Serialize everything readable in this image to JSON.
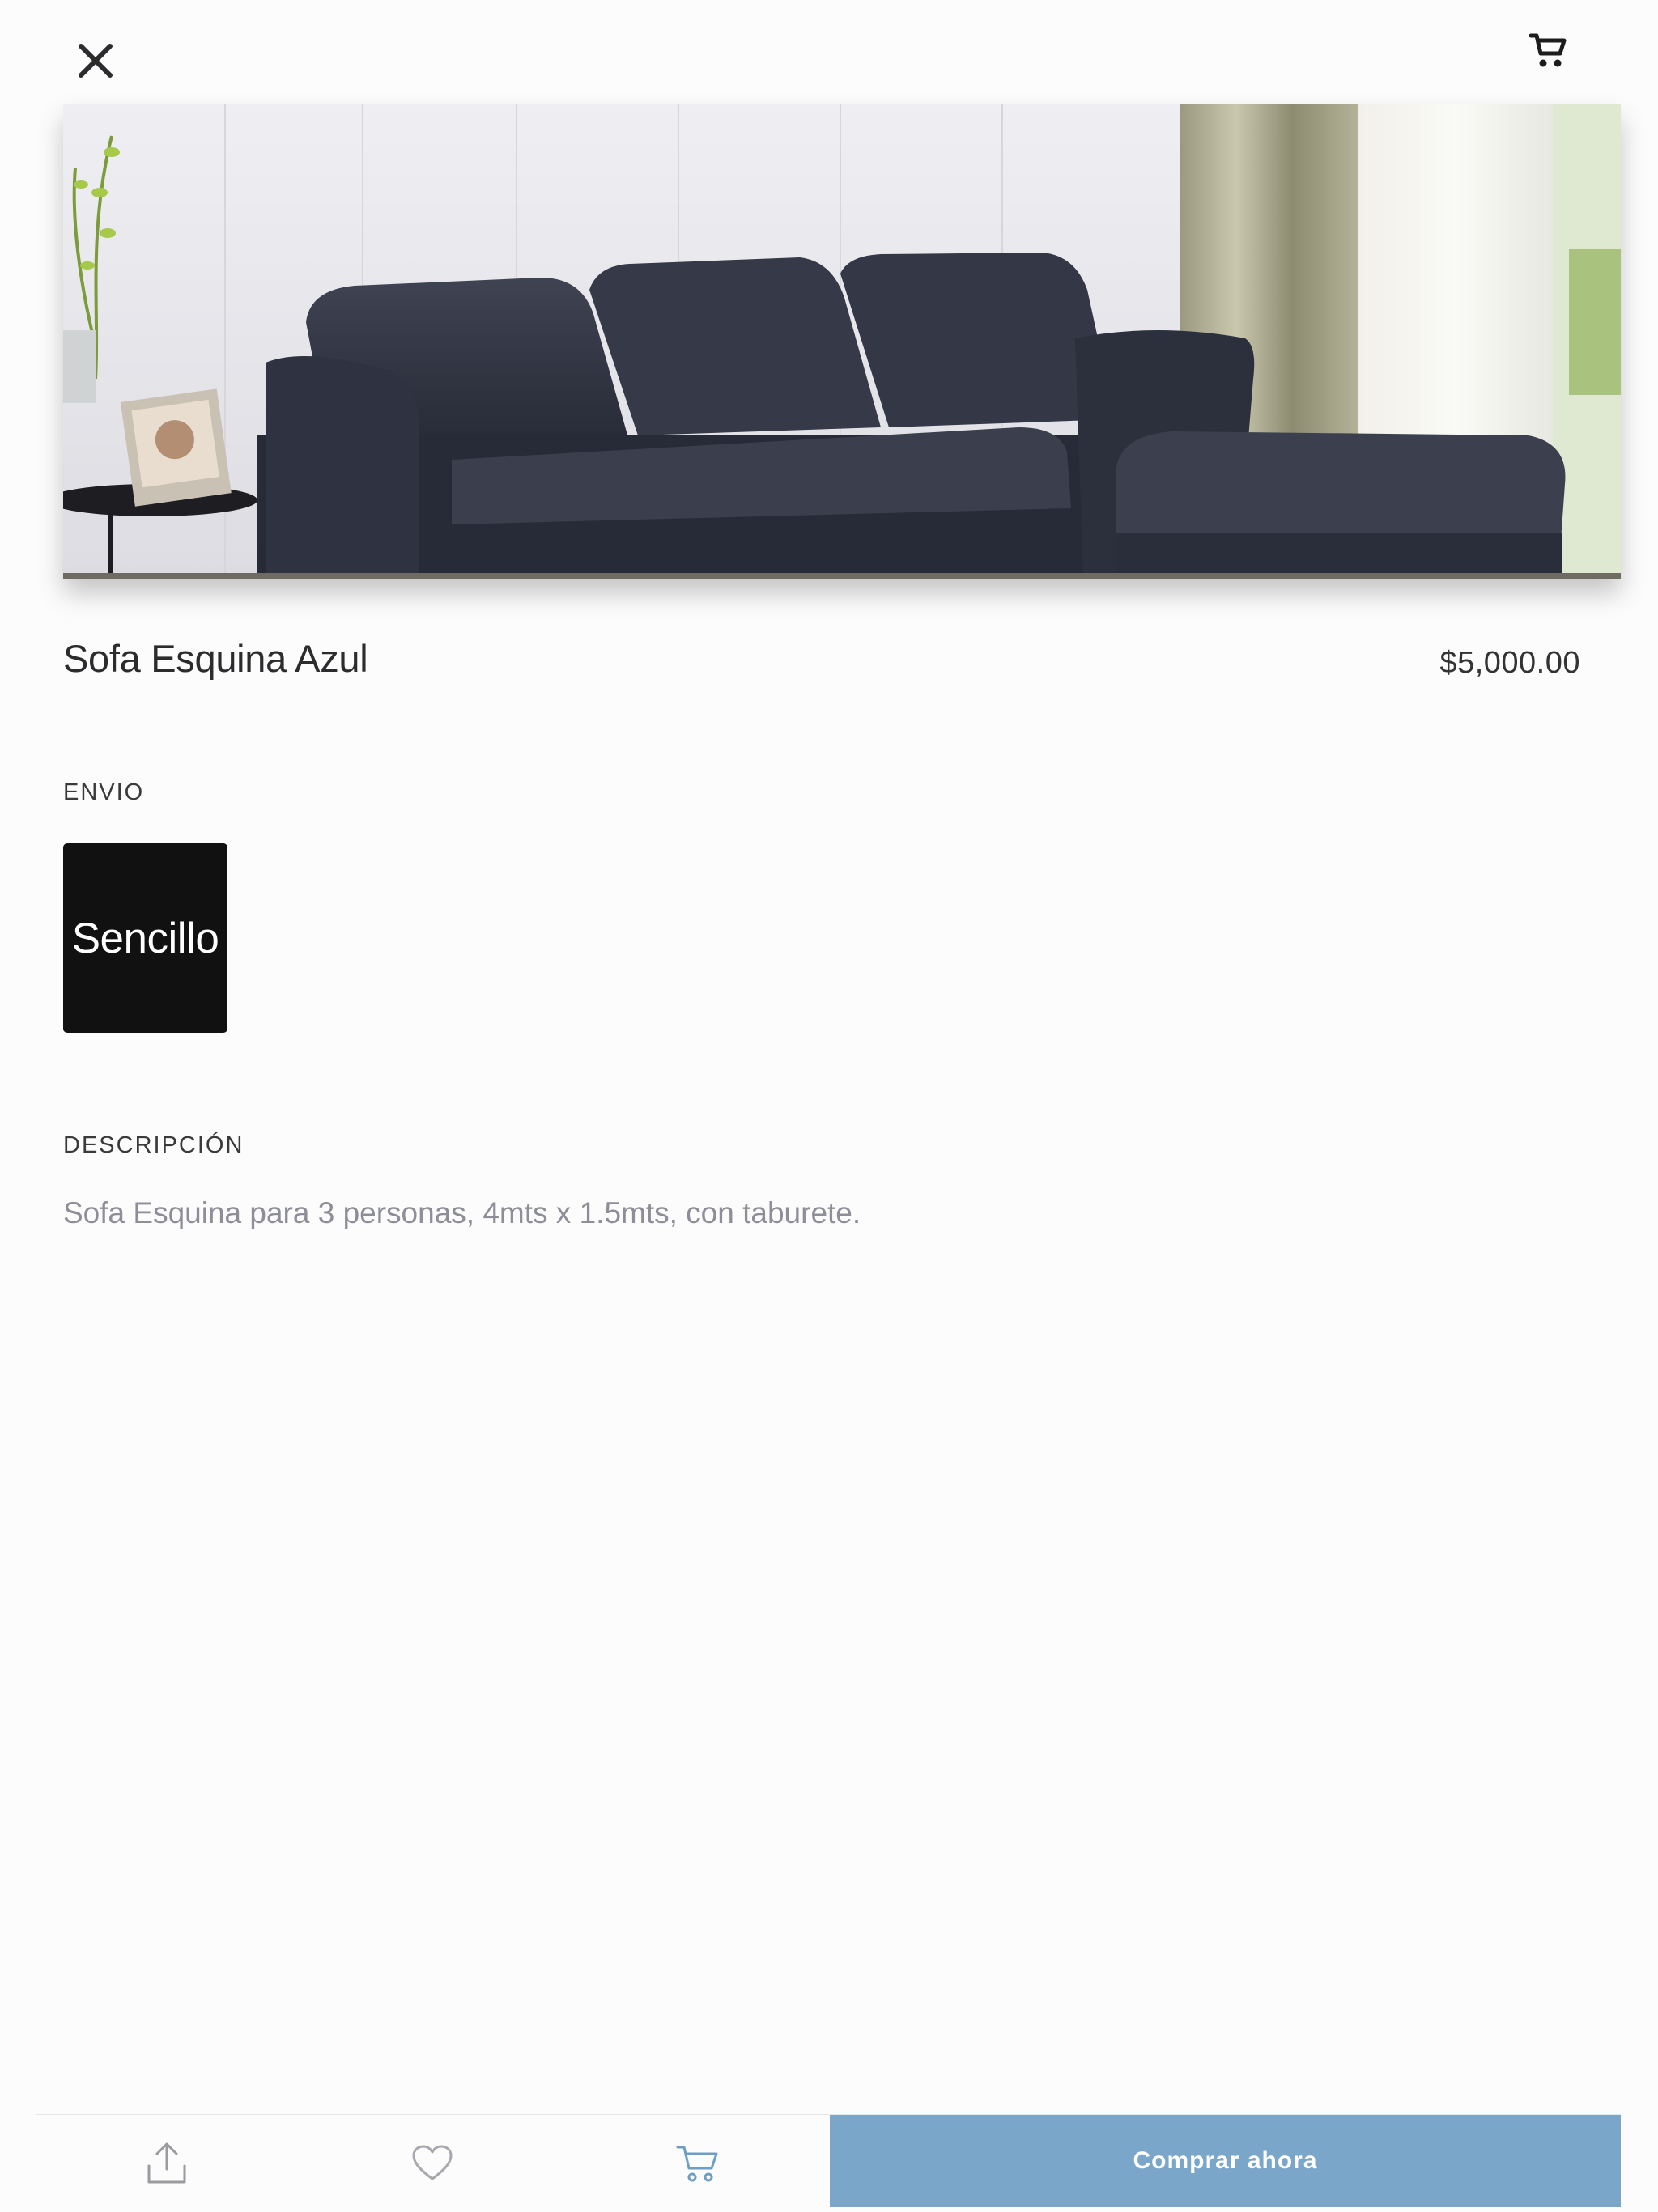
{
  "header": {
    "close_icon": "close-icon",
    "cart_icon": "cart-icon"
  },
  "hero": {
    "image_subject": "dark blue corner sofa with ottoman in a living room"
  },
  "product": {
    "name": "Sofa Esquina Azul",
    "price": "$5,000.00"
  },
  "shipping": {
    "label": "ENVIO",
    "selected": "Sencillo"
  },
  "description": {
    "label": "DESCRIPCIÓN",
    "text": "Sofa Esquina para 3 personas, 4mts x 1.5mts, con taburete."
  },
  "bottom_bar": {
    "share_icon": "share-icon",
    "favorite_icon": "heart-icon",
    "cart_icon": "cart-icon",
    "buy_label": "Comprar ahora"
  },
  "colors": {
    "accent": "#7aa6c9",
    "option_bg": "#111111",
    "description_text": "#8e8e98"
  }
}
